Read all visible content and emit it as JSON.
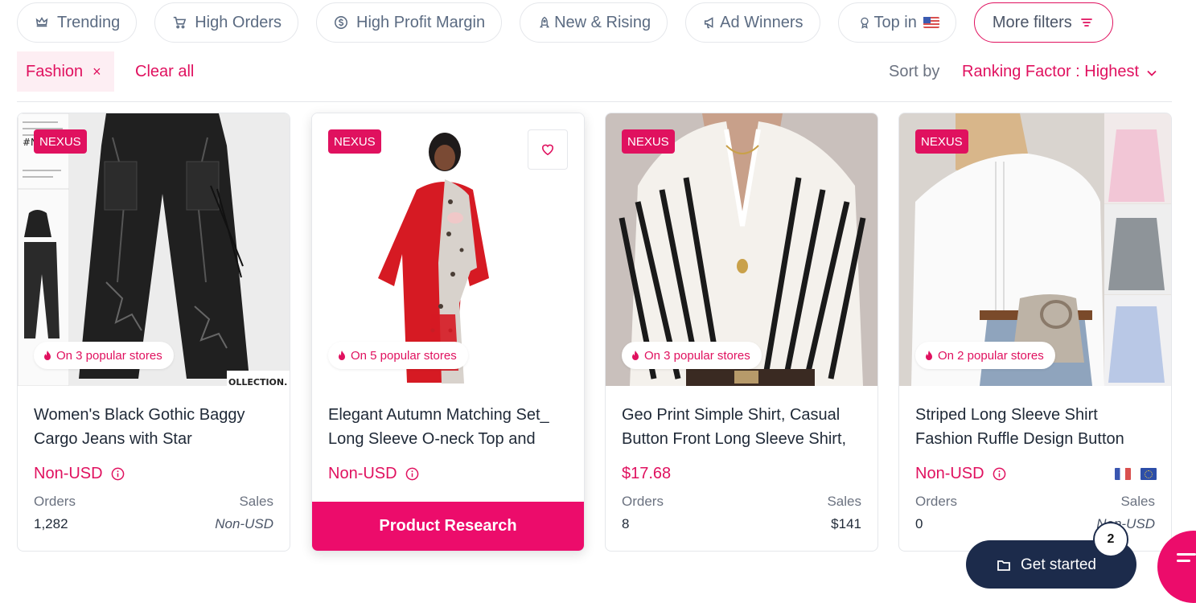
{
  "filters": [
    {
      "label": "Trending",
      "icon": "crown-icon"
    },
    {
      "label": "High Orders",
      "icon": "cart-icon"
    },
    {
      "label": "High Profit Margin",
      "icon": "dollar-circle-icon"
    },
    {
      "label": "New & Rising",
      "icon": "rocket-icon"
    },
    {
      "label": "Ad Winners",
      "icon": "megaphone-icon"
    },
    {
      "label": "Top in",
      "icon": "award-icon",
      "flag": "us-flag-icon"
    }
  ],
  "more_filters": "More filters",
  "active_chip": {
    "label": "Fashion",
    "remove": "×"
  },
  "clear_all": "Clear all",
  "sort": {
    "label": "Sort by",
    "value": "Ranking Factor : Highest"
  },
  "badge_text": "NEXUS",
  "orders_label": "Orders",
  "sales_label": "Sales",
  "accent_color": "#e0115f",
  "products": [
    {
      "title": "Women's Black Gothic Baggy Cargo Jeans with Star",
      "popular": "On 3 popular stores",
      "price": "Non-USD",
      "orders": "1,282",
      "sales": "Non-USD"
    },
    {
      "title": "Elegant Autumn Matching Set_ Long Sleeve O-neck Top and",
      "popular": "On 5 popular stores",
      "price": "Non-USD",
      "cta": "Product Research"
    },
    {
      "title": "Geo Print Simple Shirt, Casual Button Front Long Sleeve Shirt,",
      "popular": "On 3 popular stores",
      "price": "$17.68",
      "orders": "8",
      "sales": "$141"
    },
    {
      "title": "Striped Long Sleeve Shirt Fashion Ruffle Design Button",
      "popular": "On 2 popular stores",
      "price": "Non-USD",
      "orders": "0",
      "sales": "Non-USD",
      "flags": [
        "fr-flag-icon",
        "eu-flag-icon"
      ]
    }
  ],
  "product_images": [
    {
      "overlay_text_1": "#N",
      "overlay_text_2": "OLLECTION."
    }
  ],
  "get_started": {
    "label": "Get started",
    "count": "2"
  }
}
